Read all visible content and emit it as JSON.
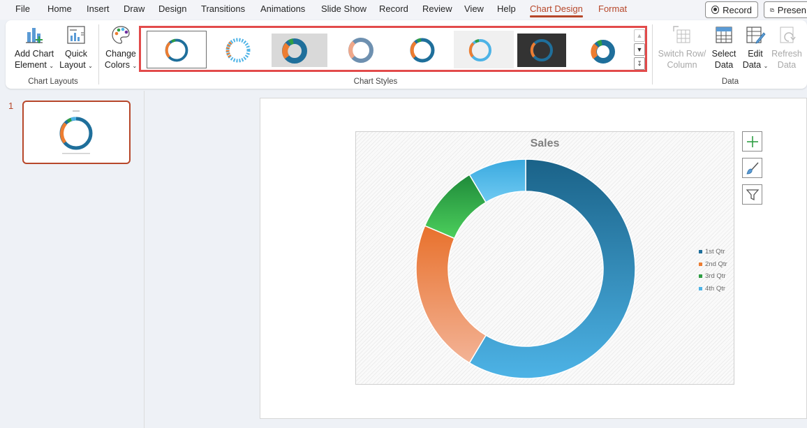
{
  "menu": {
    "items": [
      "File",
      "Home",
      "Insert",
      "Draw",
      "Design",
      "Transitions",
      "Animations",
      "Slide Show",
      "Record",
      "Review",
      "View",
      "Help",
      "Chart Design",
      "Format"
    ],
    "record_button": "Record",
    "present_button": "Presen"
  },
  "ribbon": {
    "add_chart_element": [
      "Add Chart",
      "Element"
    ],
    "quick_layout": [
      "Quick",
      "Layout"
    ],
    "change_colors": [
      "Change",
      "Colors"
    ],
    "switch_row_column": [
      "Switch Row/",
      "Column"
    ],
    "select_data": [
      "Select",
      "Data"
    ],
    "edit_data": [
      "Edit",
      "Data"
    ],
    "refresh_data": [
      "Refresh",
      "Data"
    ],
    "groups": {
      "chart_layouts": "Chart Layouts",
      "chart_styles": "Chart Styles",
      "data": "Data"
    }
  },
  "slide_panel": {
    "slide_number": "1"
  },
  "colors": {
    "accent": "#b7472a",
    "q1": "#1f6f9b",
    "q2": "#ed7d31",
    "q3": "#2f9e44",
    "q4": "#4db3e6"
  },
  "chart_data": {
    "type": "pie",
    "variant": "doughnut",
    "title": "Sales",
    "categories": [
      "1st Qtr",
      "2nd Qtr",
      "3rd Qtr",
      "4th Qtr"
    ],
    "values": [
      8.2,
      3.2,
      1.4,
      1.2
    ],
    "legend": "right"
  }
}
